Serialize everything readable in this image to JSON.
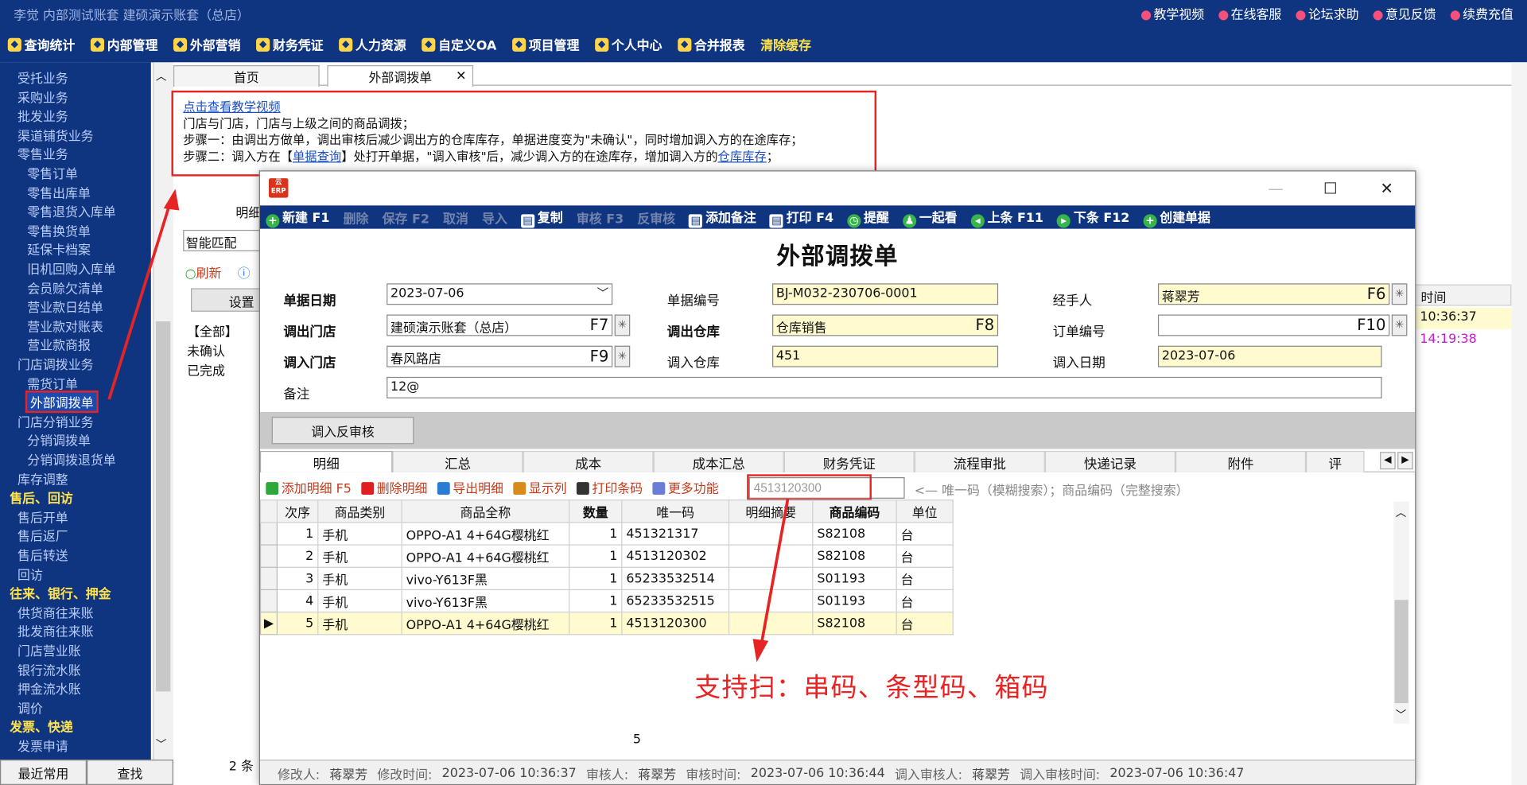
{
  "header": {
    "account": "李觉  内部测试账套    建硕演示账套（总店）",
    "top_links": [
      {
        "label": "教学视频",
        "icon": "play-icon"
      },
      {
        "label": "在线客服",
        "icon": "headset-icon"
      },
      {
        "label": "论坛求助",
        "icon": "forum-icon"
      },
      {
        "label": "意见反馈",
        "icon": "pen-icon"
      },
      {
        "label": "续费充值",
        "icon": "chat-icon"
      }
    ],
    "main_menu": [
      {
        "label": "查询统计",
        "icon": "chart-icon"
      },
      {
        "label": "内部管理",
        "icon": "diamond-icon"
      },
      {
        "label": "外部营销",
        "icon": "bag-icon"
      },
      {
        "label": "财务凭证",
        "icon": "book-icon"
      },
      {
        "label": "人力资源",
        "icon": "person-icon"
      },
      {
        "label": "自定义OA",
        "icon": "tools-icon"
      },
      {
        "label": "项目管理",
        "icon": "gear-icon"
      },
      {
        "label": "个人中心",
        "icon": "heart-icon"
      },
      {
        "label": "合并报表",
        "icon": "doc-icon"
      },
      {
        "label": "清除缓存",
        "icon": ""
      }
    ]
  },
  "sidebar": {
    "items": [
      {
        "label": "受托业务",
        "kind": "item"
      },
      {
        "label": "采购业务",
        "kind": "item"
      },
      {
        "label": "批发业务",
        "kind": "item"
      },
      {
        "label": "渠道铺货业务",
        "kind": "item"
      },
      {
        "label": "零售业务",
        "kind": "item"
      },
      {
        "label": "零售订单",
        "kind": "sub"
      },
      {
        "label": "零售出库单",
        "kind": "sub"
      },
      {
        "label": "零售退货入库单",
        "kind": "sub"
      },
      {
        "label": "零售换货单",
        "kind": "sub"
      },
      {
        "label": "延保卡档案",
        "kind": "sub"
      },
      {
        "label": "旧机回购入库单",
        "kind": "sub"
      },
      {
        "label": "会员赊欠清单",
        "kind": "sub"
      },
      {
        "label": "营业款日结单",
        "kind": "sub"
      },
      {
        "label": "营业款对账表",
        "kind": "sub"
      },
      {
        "label": "营业款商报",
        "kind": "sub"
      },
      {
        "label": "门店调拨业务",
        "kind": "item"
      },
      {
        "label": "需货订单",
        "kind": "sub"
      },
      {
        "label": "外部调拨单",
        "kind": "selected"
      },
      {
        "label": "门店分销业务",
        "kind": "item"
      },
      {
        "label": "分销调拨单",
        "kind": "sub"
      },
      {
        "label": "分销调拨退货单",
        "kind": "sub"
      },
      {
        "label": "库存调整",
        "kind": "item"
      },
      {
        "label": "售后、回访",
        "kind": "group"
      },
      {
        "label": "售后开单",
        "kind": "item"
      },
      {
        "label": "售后返厂",
        "kind": "item"
      },
      {
        "label": "售后转送",
        "kind": "item"
      },
      {
        "label": "回访",
        "kind": "item"
      },
      {
        "label": "往来、银行、押金",
        "kind": "group"
      },
      {
        "label": "供货商往来账",
        "kind": "item"
      },
      {
        "label": "批发商往来账",
        "kind": "item"
      },
      {
        "label": "门店营业账",
        "kind": "item"
      },
      {
        "label": "银行流水账",
        "kind": "item"
      },
      {
        "label": "押金流水账",
        "kind": "item"
      },
      {
        "label": "调价",
        "kind": "item"
      },
      {
        "label": "发票、快递",
        "kind": "group"
      },
      {
        "label": "发票申请",
        "kind": "item"
      }
    ],
    "bottom_tabs": [
      "最近常用",
      "查找"
    ]
  },
  "page_tabs": [
    {
      "label": "首页"
    },
    {
      "label": "外部调拨单",
      "close": "✕"
    }
  ],
  "hint": {
    "link": "点击查看教学视频",
    "line1": "门店与门店，门店与上级之间的商品调拨；",
    "line2": "步骤一：由调出方做单，调出审核后减少调出方的仓库库存，单据进度变为\"未确认\"，同时增加调入方的在途库存；",
    "line3_a": "步骤二：调入方在【",
    "line3_link1": "单据查询",
    "line3_b": "】处打开单据，\"调入审核\"后，减少调入方的在途库存，增加调入方的",
    "line3_link2": "仓库库存",
    "line3_c": "；"
  },
  "background_page": {
    "detail_tab": "明细",
    "match_select": "智能匹配",
    "refresh": "刷新",
    "settings_btn": "设置",
    "filters": [
      "【全部】",
      "未确认",
      "已完成"
    ],
    "records": "2 条",
    "time_header": "时间",
    "times": [
      "10:36:37",
      "14:19:38"
    ]
  },
  "dialog": {
    "logo_text": "云 ERP",
    "window_buttons": {
      "minimize": "—",
      "maximize": "☐",
      "close": "✕"
    },
    "toolbar": [
      {
        "label": "新建 F1",
        "enabled": true,
        "icon": "plus-icon"
      },
      {
        "label": "删除",
        "enabled": false
      },
      {
        "label": "保存 F2",
        "enabled": false
      },
      {
        "label": "取消",
        "enabled": false
      },
      {
        "label": "导入",
        "enabled": false
      },
      {
        "label": "复制",
        "enabled": true,
        "icon": "copy-icon"
      },
      {
        "label": "审核 F3",
        "enabled": false
      },
      {
        "label": "反审核",
        "enabled": false
      },
      {
        "label": "添加备注",
        "enabled": true,
        "icon": "note-icon"
      },
      {
        "label": "打印 F4",
        "enabled": true,
        "icon": "printer-icon"
      },
      {
        "label": "提醒",
        "enabled": true,
        "icon": "clock-icon"
      },
      {
        "label": "一起看",
        "enabled": true,
        "icon": "people-icon"
      },
      {
        "label": "上条 F11",
        "enabled": true,
        "icon": "prev-icon"
      },
      {
        "label": "下条 F12",
        "enabled": true,
        "icon": "next-icon"
      },
      {
        "label": "创建单据",
        "enabled": true,
        "icon": "plus-icon"
      }
    ],
    "form_title": "外部调拨单",
    "fields": {
      "doc_date": {
        "label": "单据日期",
        "value": "2023-07-06"
      },
      "doc_no": {
        "label": "单据编号",
        "value": "BJ-M032-230706-0001"
      },
      "handler": {
        "label": "经手人",
        "value": "蒋翠芳",
        "key": "F6"
      },
      "out_store": {
        "label": "调出门店",
        "value": "建硕演示账套（总店）",
        "key": "F7"
      },
      "out_wh": {
        "label": "调出仓库",
        "value": "仓库销售",
        "key": "F8"
      },
      "order_no": {
        "label": "订单编号",
        "value": "",
        "key": "F10"
      },
      "in_store": {
        "label": "调入门店",
        "value": "春风路店",
        "key": "F9"
      },
      "in_wh": {
        "label": "调入仓库",
        "value": "451"
      },
      "in_date": {
        "label": "调入日期",
        "value": "2023-07-06"
      },
      "remark": {
        "label": "备注",
        "value": "12@"
      }
    },
    "reverse_btn": "调入反审核",
    "sub_tabs": [
      "明细",
      "汇总",
      "成本",
      "成本汇总",
      "财务凭证",
      "流程审批",
      "快递记录",
      "附件",
      "评"
    ],
    "detail_toolbar": [
      {
        "label": "添加明细 F5",
        "icon": "plus-icon",
        "color": "#2fa83a"
      },
      {
        "label": "删除明细",
        "icon": "cross-icon",
        "color": "#e02020"
      },
      {
        "label": "导出明细",
        "icon": "export-icon",
        "color": "#2a7bd4"
      },
      {
        "label": "显示列",
        "icon": "columns-icon",
        "color": "#d88a1a"
      },
      {
        "label": "打印条码",
        "icon": "barcode-icon",
        "color": "#333333"
      },
      {
        "label": "更多功能",
        "icon": "grid-icon",
        "color": "#6a7ed8"
      }
    ],
    "scan_input": "4513120300",
    "scan_hint": "<— 唯一码（模糊搜索）；商品编码（完整搜索）",
    "columns": [
      "次序",
      "商品类别",
      "商品全称",
      "数量",
      "唯一码",
      "明细摘要",
      "商品编码",
      "单位"
    ],
    "rows": [
      {
        "seq": "1",
        "cat": "手机",
        "name": "OPPO-A1 4+64G樱桃红",
        "qty": "1",
        "code": "451321317",
        "memo": "",
        "sku": "S82108",
        "unit": "台"
      },
      {
        "seq": "2",
        "cat": "手机",
        "name": "OPPO-A1 4+64G樱桃红",
        "qty": "1",
        "code": "4513120302",
        "memo": "",
        "sku": "S82108",
        "unit": "台"
      },
      {
        "seq": "3",
        "cat": "手机",
        "name": "vivo-Y613F黑",
        "qty": "1",
        "code": "65233532514",
        "memo": "",
        "sku": "S01193",
        "unit": "台"
      },
      {
        "seq": "4",
        "cat": "手机",
        "name": "vivo-Y613F黑",
        "qty": "1",
        "code": "65233532515",
        "memo": "",
        "sku": "S01193",
        "unit": "台"
      },
      {
        "seq": "5",
        "cat": "手机",
        "name": "OPPO-A1 4+64G樱桃红",
        "qty": "1",
        "code": "4513120300",
        "memo": "",
        "sku": "S82108",
        "unit": "台"
      }
    ],
    "annotation": "支持扫：串码、条型码、箱码",
    "total_qty": "5",
    "status": [
      {
        "label": "修改人:",
        "value": "蒋翠芳"
      },
      {
        "label": "修改时间:",
        "value": "2023-07-06 10:36:37"
      },
      {
        "label": "审核人:",
        "value": "蒋翠芳"
      },
      {
        "label": "审核时间:",
        "value": "2023-07-06 10:36:44"
      },
      {
        "label": "调入审核人:",
        "value": "蒋翠芳"
      },
      {
        "label": "调入审核时间:",
        "value": "2023-07-06 10:36:47"
      }
    ]
  }
}
